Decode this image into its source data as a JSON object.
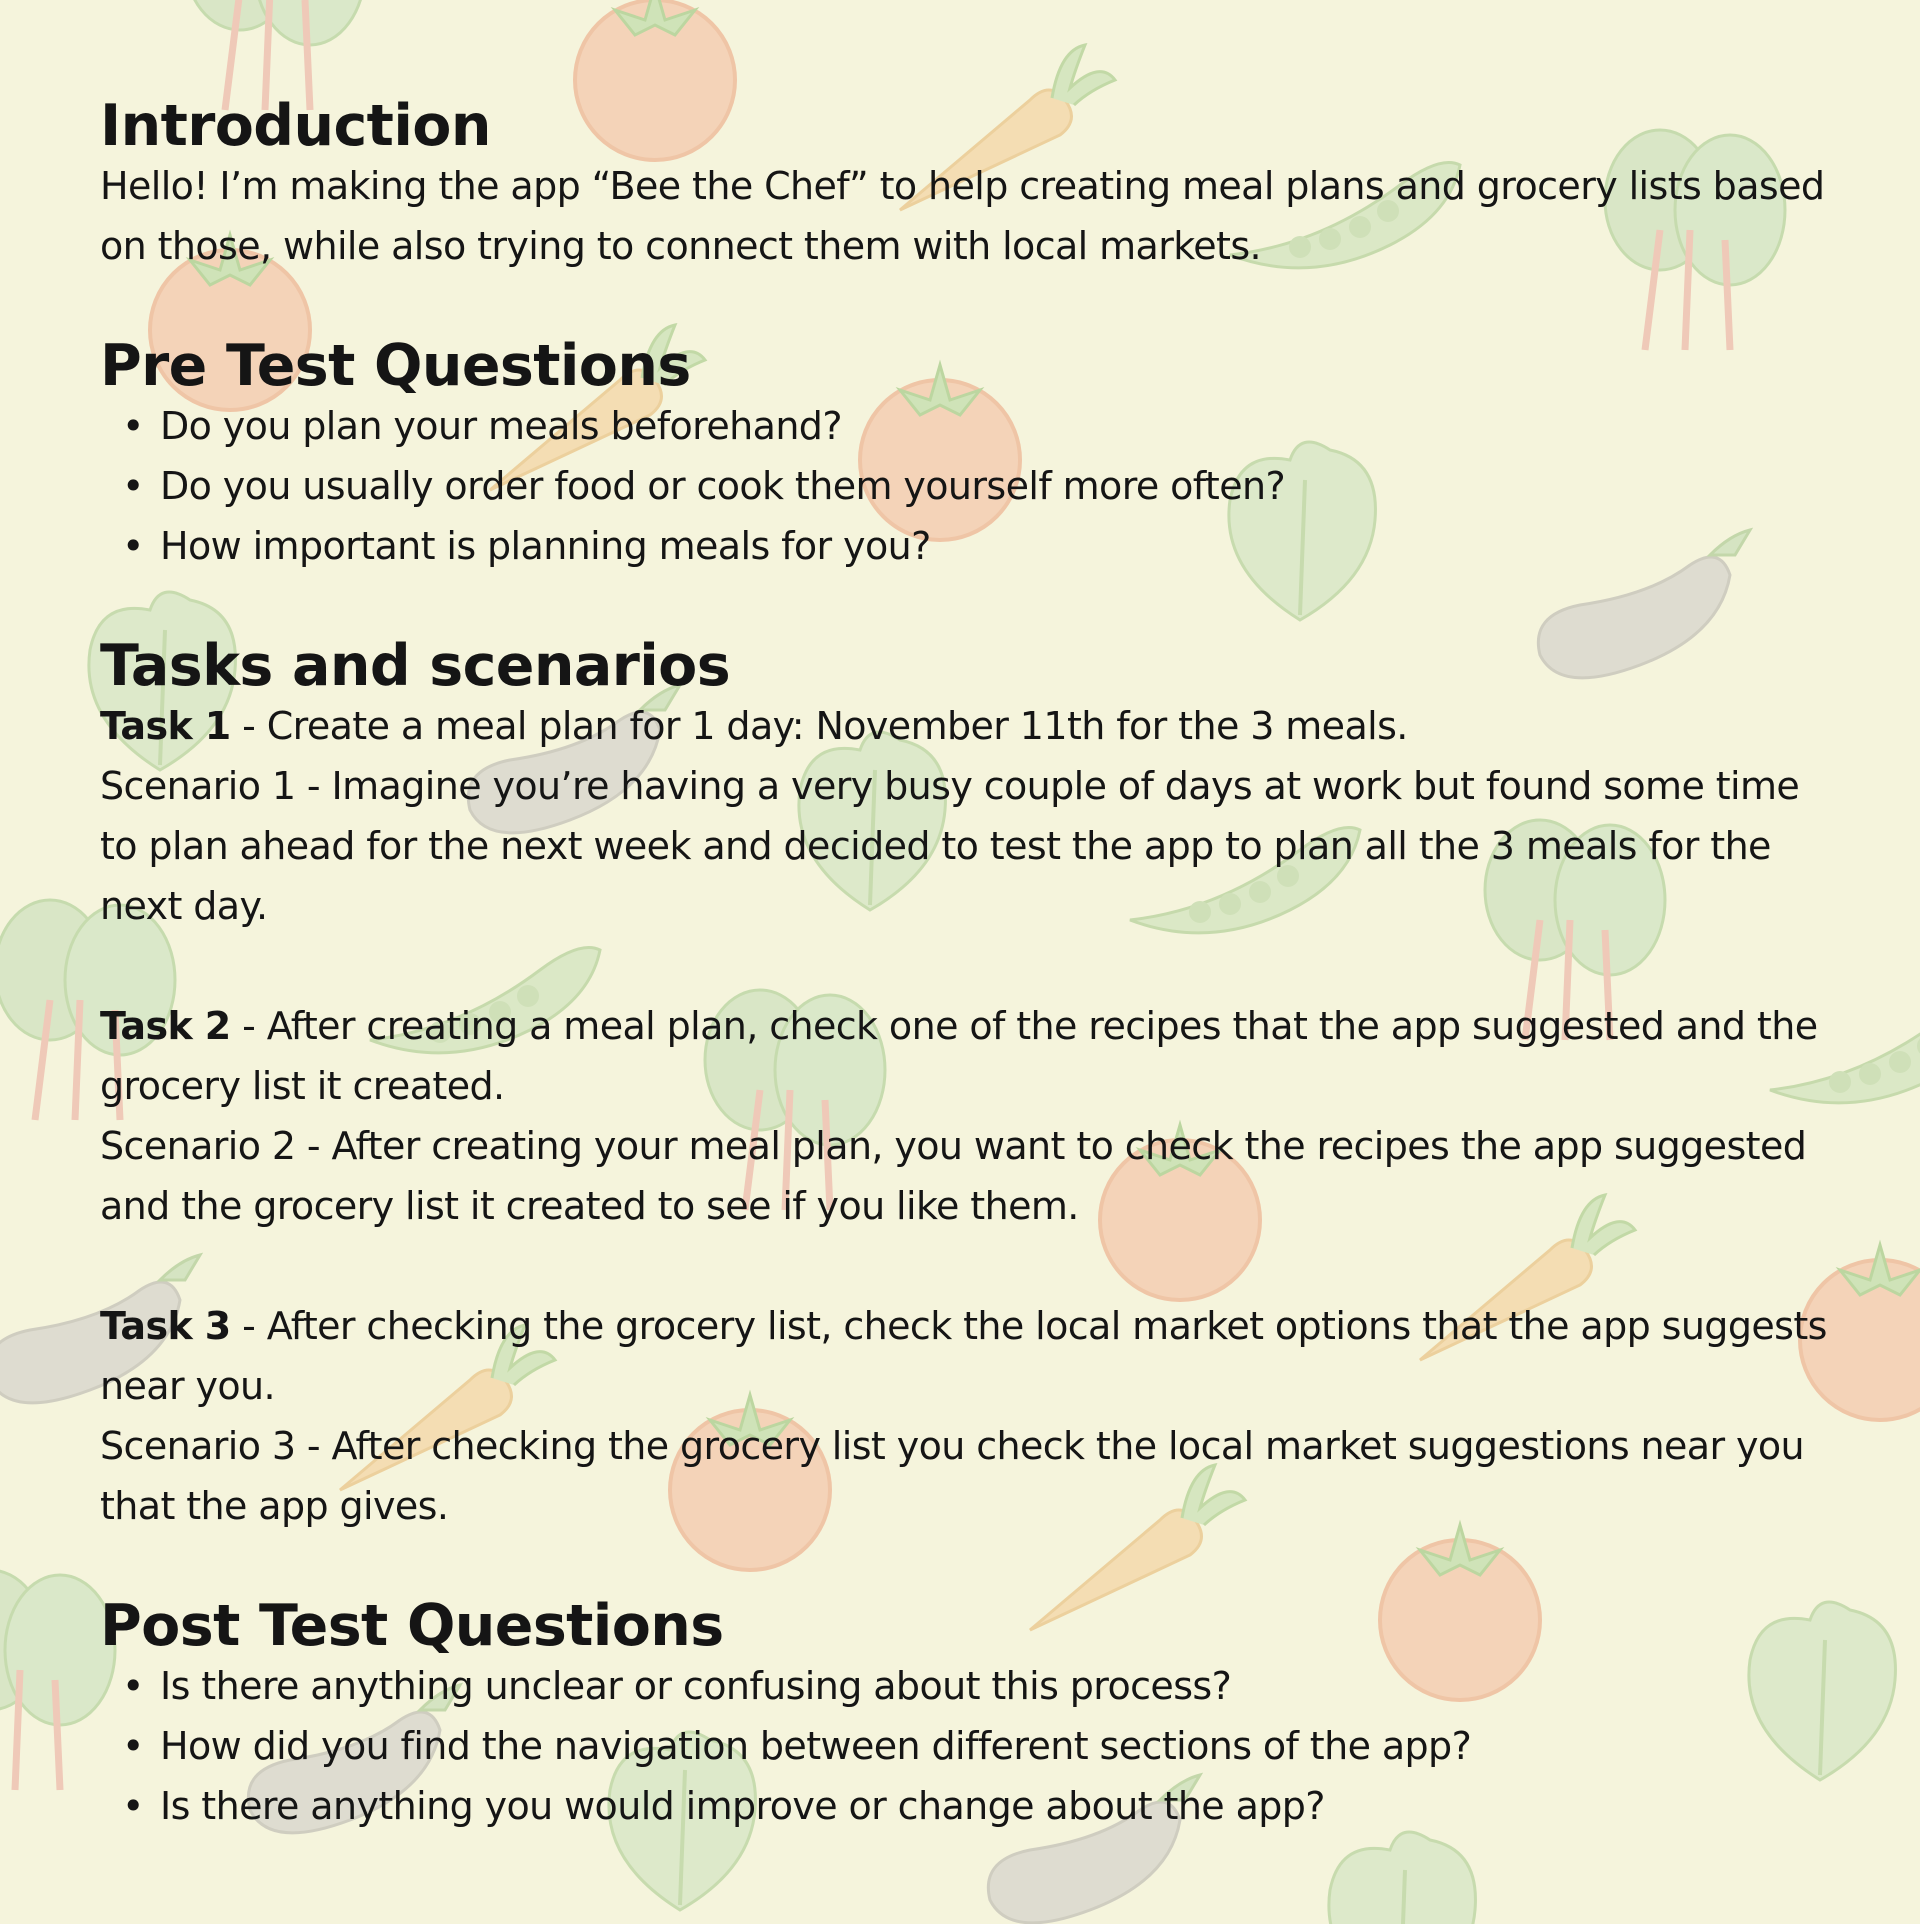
{
  "background": {
    "color": "#f5f4dc",
    "motif": "vegetable-pattern",
    "icons": [
      "tomato-icon",
      "carrot-icon",
      "spinach-icon",
      "peapod-icon",
      "eggplant-icon",
      "lettuce-icon"
    ]
  },
  "intro": {
    "heading": "Introduction",
    "text": "Hello! I’m making the app “Bee the Chef” to help creating meal plans and grocery lists based on those, while also trying to connect them with local markets."
  },
  "pre_test": {
    "heading": "Pre Test Questions",
    "items": [
      "Do you plan your meals beforehand?",
      "Do you usually order food or cook them yourself more often?",
      "How important is planning meals for you?"
    ]
  },
  "tasks": {
    "heading": "Tasks and scenarios",
    "list": [
      {
        "task_label": "Task 1",
        "task_text": " - Create a meal plan for 1 day: November 11th for the 3 meals.",
        "scenario": "Scenario 1 - Imagine you’re having a very busy couple of days at work but found some time to plan ahead for the next week and decided to test the app to plan all the 3 meals for the next day."
      },
      {
        "task_label": "Task 2",
        "task_text": " - After creating a meal plan, check one of the recipes that the app suggested and the grocery list it created.",
        "scenario": "Scenario 2 - After creating your meal plan, you want to check the recipes the app suggested and the grocery list it created to see if you like them."
      },
      {
        "task_label": "Task 3",
        "task_text": " - After checking the grocery list, check the local market options that the app suggests near you.",
        "scenario": "Scenario 3 - After  checking the grocery list you check the local market suggestions near you that the app gives."
      }
    ]
  },
  "post_test": {
    "heading": "Post Test Questions",
    "items": [
      "Is there anything unclear or confusing about this process?",
      "How did you find the navigation between different sections of the app?",
      "Is there anything you would improve or change about the app?"
    ]
  }
}
